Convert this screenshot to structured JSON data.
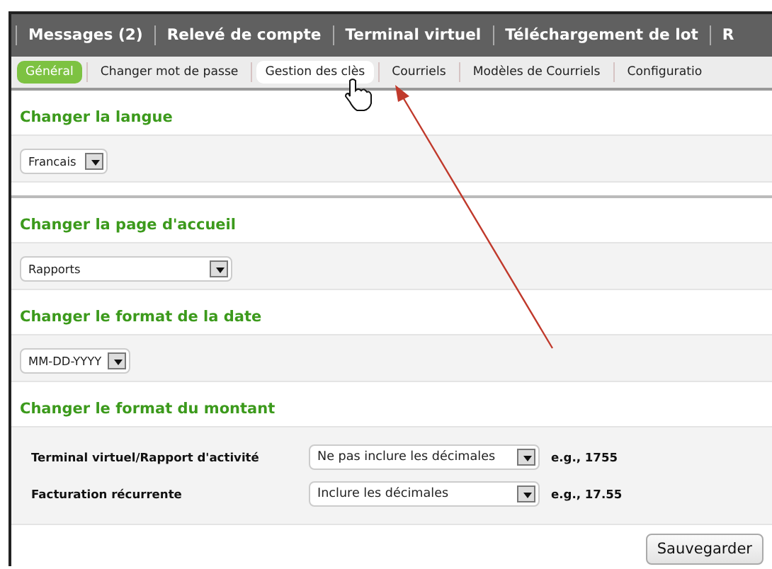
{
  "top_nav": {
    "items": [
      {
        "label": "Messages (2)"
      },
      {
        "label": "Relevé de compte"
      },
      {
        "label": "Terminal virtuel"
      },
      {
        "label": "Téléchargement de lot"
      },
      {
        "label": "R"
      }
    ]
  },
  "sub_nav": {
    "tabs": [
      {
        "label": "Général",
        "selected": true,
        "highlighted": false
      },
      {
        "label": "Changer mot de passe",
        "selected": false,
        "highlighted": false
      },
      {
        "label": "Gestion des clès",
        "selected": false,
        "highlighted": true
      },
      {
        "label": "Courriels",
        "selected": false,
        "highlighted": false
      },
      {
        "label": "Modèles de Courriels",
        "selected": false,
        "highlighted": false
      },
      {
        "label": "Configuratio",
        "selected": false,
        "highlighted": false
      }
    ]
  },
  "language_settings": [
    {
      "kind": "select",
      "title": "Changer la langue",
      "value": "Francais"
    }
  ],
  "display_settings": [
    {
      "kind": "select",
      "title": "Changer la page d'accueil",
      "value": "Rapports"
    },
    {
      "kind": "select",
      "title": "Changer le format de la date",
      "value": "MM-DD-YYYY"
    },
    {
      "kind": "rows",
      "title": "Changer le format du montant",
      "rows": [
        {
          "label": "Terminal virtuel/Rapport d'activité",
          "value": "Ne pas inclure les décimales",
          "example": "e.g., 1755"
        },
        {
          "label": "Facturation récurrente",
          "value": "Inclure les décimales",
          "example": "e.g., 17.55"
        }
      ]
    }
  ],
  "save_button": {
    "label": "Sauvegarder"
  }
}
